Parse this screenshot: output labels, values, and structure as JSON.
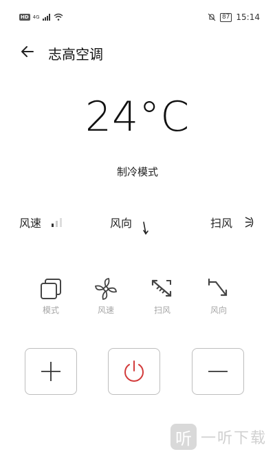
{
  "status_bar": {
    "network_badge": "HD",
    "network_type": "4G",
    "battery": "87",
    "time": "15:14"
  },
  "header": {
    "title": "志高空调"
  },
  "temperature": "24°C",
  "mode_text": "制冷模式",
  "info_row": {
    "fan_speed_label": "风速",
    "direction_label": "风向",
    "swing_label": "扫风"
  },
  "controls": [
    {
      "label": "模式",
      "icon": "mode-icon"
    },
    {
      "label": "风速",
      "icon": "fan-icon"
    },
    {
      "label": "扫风",
      "icon": "swing-icon"
    },
    {
      "label": "风向",
      "icon": "direction-icon"
    }
  ],
  "buttons": [
    {
      "name": "plus",
      "icon": "plus-icon"
    },
    {
      "name": "power",
      "icon": "power-icon"
    },
    {
      "name": "minus",
      "icon": "minus-icon"
    }
  ],
  "colors": {
    "power_red": "#d23a3a",
    "label_gray": "#a6a6a6"
  },
  "watermark": {
    "logo_char": "听",
    "text": "一听下载"
  }
}
